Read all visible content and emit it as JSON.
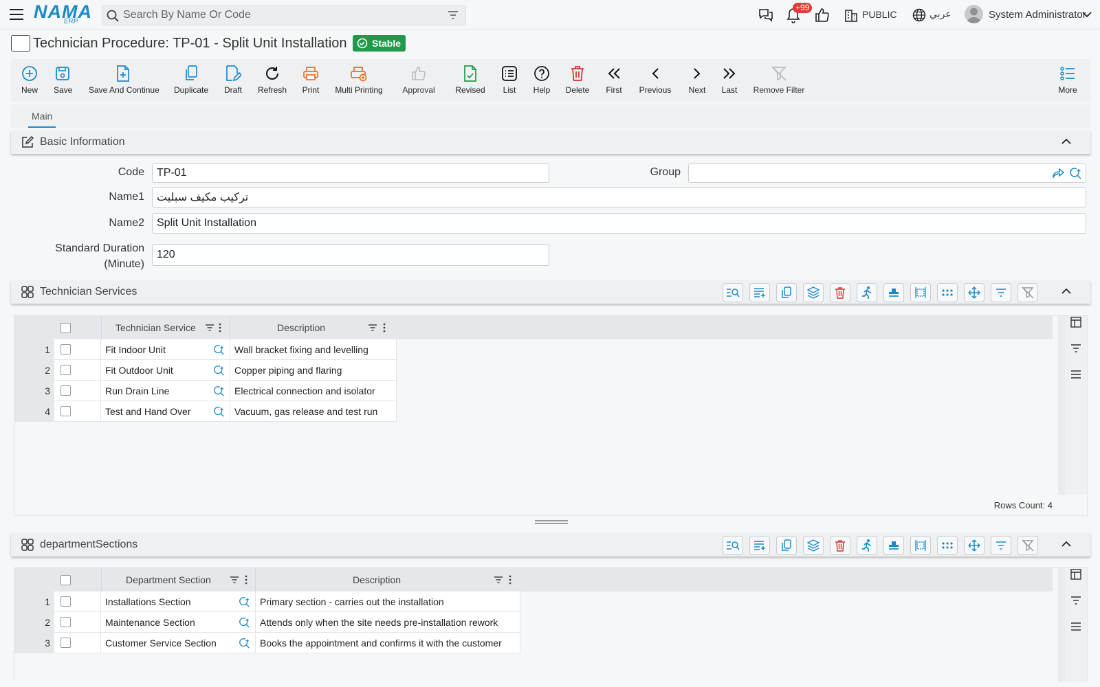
{
  "header": {
    "logo_main": "NAMA",
    "logo_sub": "ERP",
    "search_placeholder": "Search By Name Or Code",
    "notification_count": "+99",
    "branch": "PUBLIC",
    "language": "عربي",
    "user_name": "System Administrator"
  },
  "page": {
    "title": "Technician Procedure: TP-01 - Split Unit Installation",
    "status": "Stable"
  },
  "toolbar": {
    "items": [
      "New",
      "Save",
      "Save And Continue",
      "Duplicate",
      "Draft",
      "Refresh",
      "Print",
      "Multi Printing",
      "Approval",
      "Revised",
      "List",
      "Help",
      "Delete",
      "First",
      "Previous",
      "Next",
      "Last",
      "Remove Filter",
      "More"
    ]
  },
  "tabs": [
    "Main"
  ],
  "basic_info": {
    "title": "Basic Information",
    "code_label": "Code",
    "code_value": "TP-01",
    "group_label": "Group",
    "group_value": "",
    "name1_label": "Name1",
    "name1_value": "تركيب مكيف سبليت",
    "name2_label": "Name2",
    "name2_value": "Split Unit Installation",
    "duration_label_1": "Standard Duration",
    "duration_label_2": "(Minute)",
    "duration_value": "120"
  },
  "technician_services": {
    "title": "Technician Services",
    "columns": [
      "Technician Service",
      "Description"
    ],
    "rows": [
      {
        "num": "1",
        "service": "Fit Indoor Unit",
        "description": "Wall bracket fixing and levelling"
      },
      {
        "num": "2",
        "service": "Fit Outdoor Unit",
        "description": "Copper piping and flaring"
      },
      {
        "num": "3",
        "service": "Run Drain Line",
        "description": "Electrical connection and isolator"
      },
      {
        "num": "4",
        "service": "Test and Hand Over",
        "description": "Vacuum, gas release and test run"
      }
    ],
    "rows_count": "Rows Count: 4"
  },
  "department_sections": {
    "title": "departmentSections",
    "columns": [
      "Department Section",
      "Description"
    ],
    "rows": [
      {
        "num": "1",
        "section": "Installations Section",
        "description": "Primary section - carries out the installation"
      },
      {
        "num": "2",
        "section": "Maintenance Section",
        "description": "Attends only when the site needs pre-installation rework"
      },
      {
        "num": "3",
        "section": "Customer Service Section",
        "description": "Books the appointment and confirms it with the customer"
      }
    ]
  },
  "colors": {
    "accent": "#1d89c9",
    "stable": "#1e9a4a",
    "danger": "#e53935",
    "print": "#e8711f",
    "approval_disabled": "#b9bcbf"
  }
}
